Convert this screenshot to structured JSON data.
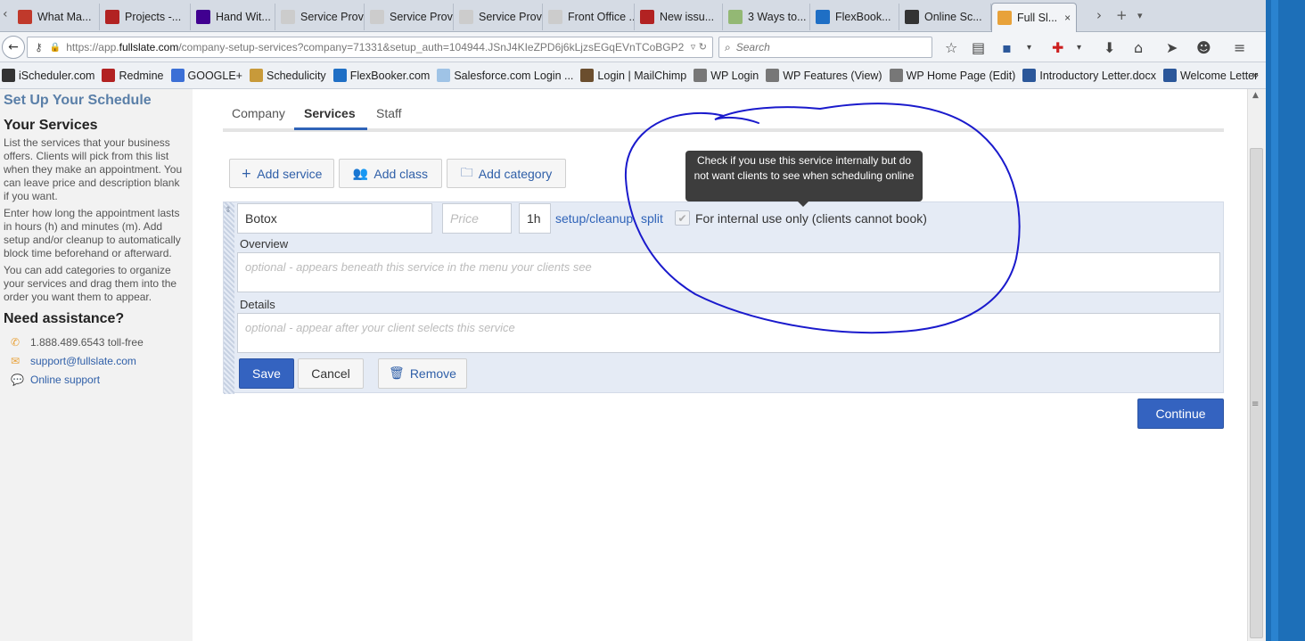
{
  "browser": {
    "tabs": [
      {
        "label": "What Ma...",
        "icon": "news-icon",
        "color": "#c0392b"
      },
      {
        "label": "Projects -...",
        "icon": "redmine-icon",
        "color": "#b22222"
      },
      {
        "label": "Hand Wit...",
        "icon": "yahoo-icon",
        "color": "#400090"
      },
      {
        "label": "Service Provi...",
        "icon": "page-icon",
        "color": "#cccccc"
      },
      {
        "label": "Service Provi...",
        "icon": "page-icon",
        "color": "#cccccc"
      },
      {
        "label": "Service Provi...",
        "icon": "page-icon",
        "color": "#cccccc"
      },
      {
        "label": "Front Office ...",
        "icon": "page-icon",
        "color": "#cccccc"
      },
      {
        "label": "New issu...",
        "icon": "redmine-icon",
        "color": "#b22222"
      },
      {
        "label": "3 Ways to...",
        "icon": "wikihow-icon",
        "color": "#93b874"
      },
      {
        "label": "FlexBook...",
        "icon": "flexbooker-icon",
        "color": "#1f6fc5"
      },
      {
        "label": "Online Sc...",
        "icon": "schedulicity-icon",
        "color": "#333333"
      },
      {
        "label": "Full Sl...",
        "icon": "calendar-icon",
        "color": "#e8a23a"
      }
    ],
    "close_glyph": "×",
    "url_prefix": "https://app.",
    "url_host": "fullslate.com",
    "url_rest": "/company-setup-services?company=71331&setup_auth=104944.JSnJ4KIeZPD6j6kLjzsEGqEVnTCoBGP2",
    "search_placeholder": "Search",
    "bookmarks": [
      {
        "label": "iScheduler.com",
        "icon": "wifi-icon",
        "color": "#333333"
      },
      {
        "label": "Redmine",
        "icon": "redmine-icon",
        "color": "#b22222"
      },
      {
        "label": "GOOGLE+",
        "icon": "google-plus-icon",
        "color": "#3b6fd6"
      },
      {
        "label": "Schedulicity",
        "icon": "schedulicity-icon",
        "color": "#c89a3a"
      },
      {
        "label": "FlexBooker.com",
        "icon": "flexbooker-icon",
        "color": "#1f6fc5"
      },
      {
        "label": "Salesforce.com Login ...",
        "icon": "cloud-icon",
        "color": "#9fc3e6"
      },
      {
        "label": "Login | MailChimp",
        "icon": "mailchimp-icon",
        "color": "#6b4e2e"
      },
      {
        "label": "WP Login",
        "icon": "gauge-icon",
        "color": "#777777"
      },
      {
        "label": "WP Features (View)",
        "icon": "gauge-icon",
        "color": "#777777"
      },
      {
        "label": "WP Home Page (Edit)",
        "icon": "gauge-icon",
        "color": "#777777"
      },
      {
        "label": "Introductory Letter.docx",
        "icon": "word-icon",
        "color": "#2b579a"
      },
      {
        "label": "Welcome Letter",
        "icon": "word-icon",
        "color": "#2b579a"
      }
    ],
    "bookmarks_more": "»"
  },
  "sidebar": {
    "title": "Set Up Your Schedule",
    "heading": "Your Services",
    "paragraphs": [
      "List the services that your business offers. Clients will pick from this list when they make an appointment. You can leave price and description blank if you want.",
      "Enter how long the appointment lasts in hours (h) and minutes (m). Add setup and/or cleanup to automatically block time beforehand or afterward.",
      "You can add categories to organize your services and drag them into the order you want them to appear."
    ],
    "assist_heading": "Need assistance?",
    "phone": "1.888.489.6543 toll-free",
    "email": "support@fullslate.com",
    "online_support": "Online support"
  },
  "main": {
    "tabs": [
      "Company",
      "Services",
      "Staff"
    ],
    "add_service": "Add service",
    "add_class": "Add class",
    "add_category": "Add category",
    "service": {
      "name": "Botox",
      "price_placeholder": "Price",
      "duration": "1h",
      "setup_link": "setup/cleanup",
      "split_link": "split",
      "internal_label": "For internal use only (clients cannot book)",
      "overview_label": "Overview",
      "overview_placeholder": "optional - appears beneath this service in the menu your clients see",
      "details_label": "Details",
      "details_placeholder": "optional - appear after your client selects this service"
    },
    "tooltip": "Check if you use this service internally but do not want clients to see when scheduling online",
    "save": "Save",
    "cancel": "Cancel",
    "remove": "Remove",
    "continue": "Continue"
  },
  "colors": {
    "primary": "#3463c0",
    "link": "#2f63b8",
    "annotation": "#1a1acc"
  }
}
